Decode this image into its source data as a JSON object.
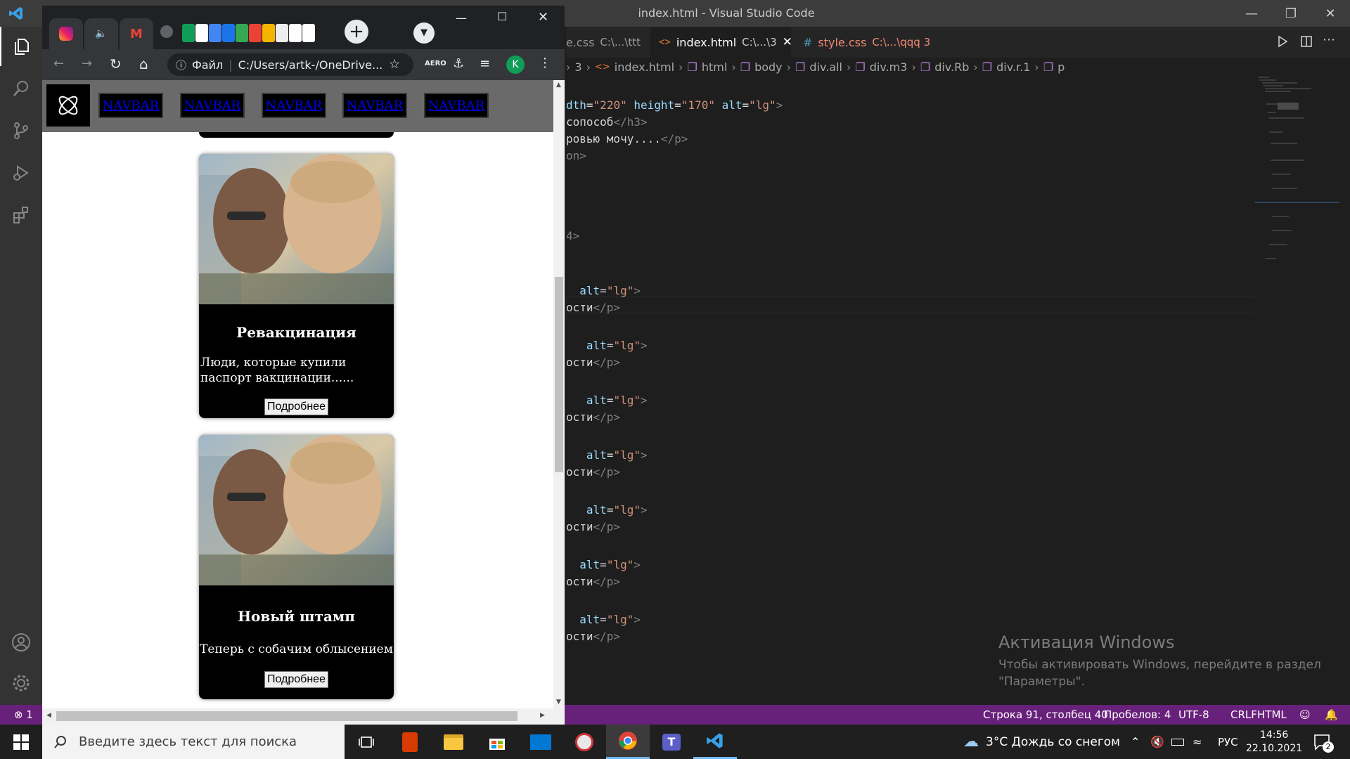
{
  "vscode": {
    "window_title": "index.html - Visual Studio Code",
    "tabs": [
      {
        "name": "e.css",
        "path": "C:\\...\\ttt",
        "active": false
      },
      {
        "name": "index.html",
        "path": "C:\\...\\3",
        "active": true
      },
      {
        "name": "style.css",
        "path": "C:\\...\\qqq 3",
        "active": false
      }
    ],
    "breadcrumb": [
      "3",
      "index.html",
      "html",
      "body",
      "div.all",
      "div.m3",
      "div.Rb",
      "div.r.1",
      "p"
    ],
    "code_lines": [
      {
        "parts": [
          [
            "attr",
            "dth"
          ],
          [
            "txt",
            "="
          ],
          [
            "str",
            "\"220\""
          ],
          [
            "txt",
            " "
          ],
          [
            "attr",
            "height"
          ],
          [
            "txt",
            "="
          ],
          [
            "str",
            "\"170\""
          ],
          [
            "txt",
            " "
          ],
          [
            "attr",
            "alt"
          ],
          [
            "txt",
            "="
          ],
          [
            "str",
            "\"lg\""
          ],
          [
            "tag",
            ">"
          ]
        ]
      },
      {
        "parts": [
          [
            "txt",
            "сопособ"
          ],
          [
            "tag",
            "</h3>"
          ]
        ]
      },
      {
        "parts": [
          [
            "txt",
            "ровью мочу...."
          ],
          [
            "tag",
            "</p>"
          ]
        ]
      },
      {
        "parts": [
          [
            "tag",
            "on>"
          ]
        ]
      },
      {
        "parts": [
          [
            "tag",
            "4>"
          ]
        ]
      },
      {
        "parts": [
          [
            "txt",
            "  "
          ],
          [
            "attr",
            "alt"
          ],
          [
            "txt",
            "="
          ],
          [
            "str",
            "\"lg\""
          ],
          [
            "tag",
            ">"
          ]
        ]
      },
      {
        "parts": [
          [
            "txt",
            "ости"
          ],
          [
            "tag",
            "</p>"
          ]
        ]
      },
      {
        "parts": [
          [
            "txt",
            "   "
          ],
          [
            "attr",
            "alt"
          ],
          [
            "txt",
            "="
          ],
          [
            "str",
            "\"lg\""
          ],
          [
            "tag",
            ">"
          ]
        ]
      },
      {
        "parts": [
          [
            "txt",
            "ости"
          ],
          [
            "tag",
            "</p>"
          ]
        ]
      },
      {
        "parts": [
          [
            "txt",
            "   "
          ],
          [
            "attr",
            "alt"
          ],
          [
            "txt",
            "="
          ],
          [
            "str",
            "\"lg\""
          ],
          [
            "tag",
            ">"
          ]
        ]
      },
      {
        "parts": [
          [
            "txt",
            "ости"
          ],
          [
            "tag",
            "</p>"
          ]
        ]
      },
      {
        "parts": [
          [
            "txt",
            "   "
          ],
          [
            "attr",
            "alt"
          ],
          [
            "txt",
            "="
          ],
          [
            "str",
            "\"lg\""
          ],
          [
            "tag",
            ">"
          ]
        ]
      },
      {
        "parts": [
          [
            "txt",
            "ости"
          ],
          [
            "tag",
            "</p>"
          ]
        ]
      },
      {
        "parts": [
          [
            "txt",
            "   "
          ],
          [
            "attr",
            "alt"
          ],
          [
            "txt",
            "="
          ],
          [
            "str",
            "\"lg\""
          ],
          [
            "tag",
            ">"
          ]
        ]
      },
      {
        "parts": [
          [
            "txt",
            "ости"
          ],
          [
            "tag",
            "</p>"
          ]
        ]
      },
      {
        "parts": [
          [
            "txt",
            "  "
          ],
          [
            "attr",
            "alt"
          ],
          [
            "txt",
            "="
          ],
          [
            "str",
            "\"lg\""
          ],
          [
            "tag",
            ">"
          ]
        ]
      },
      {
        "parts": [
          [
            "txt",
            "ости"
          ],
          [
            "tag",
            "</p>"
          ]
        ]
      },
      {
        "parts": [
          [
            "txt",
            "  "
          ],
          [
            "attr",
            "alt"
          ],
          [
            "txt",
            "="
          ],
          [
            "str",
            "\"lg\""
          ],
          [
            "tag",
            ">"
          ]
        ]
      },
      {
        "parts": [
          [
            "txt",
            "ости"
          ],
          [
            "tag",
            "</p>"
          ]
        ]
      }
    ],
    "status": {
      "errors": "1",
      "position": "Строка 91, столбец 40",
      "spaces": "Пробелов: 4",
      "encoding": "UTF-8",
      "eol": "CRLF",
      "language": "HTML"
    },
    "activation": {
      "title": "Активация Windows",
      "line1": "Чтобы активировать Windows, перейдите в раздел",
      "line2": "\"Параметры\"."
    }
  },
  "chrome": {
    "address_label": "Файл",
    "address": "C:/Users/artk-/OneDrive...",
    "profile_initial": "K",
    "aero_label": "AERO",
    "page": {
      "nav_items": [
        "NAVBAR",
        "NAVBAR",
        "NAVBAR",
        "NAVBAR",
        "NAVBAR"
      ],
      "cards": [
        {
          "title": "Ревакцинация",
          "text": "Люди, которые купили паспорт вакцинации......",
          "button": "Подробнее"
        },
        {
          "title": "Новый штамп",
          "text": "Теперь с собачим облысением",
          "button": "Подробнее"
        }
      ]
    }
  },
  "taskbar": {
    "search_placeholder": "Введите здесь текст для поиска",
    "weather": "3°C  Дождь со снегом",
    "language": "РУС",
    "time": "14:56",
    "date": "22.10.2021",
    "notifications": "2"
  }
}
